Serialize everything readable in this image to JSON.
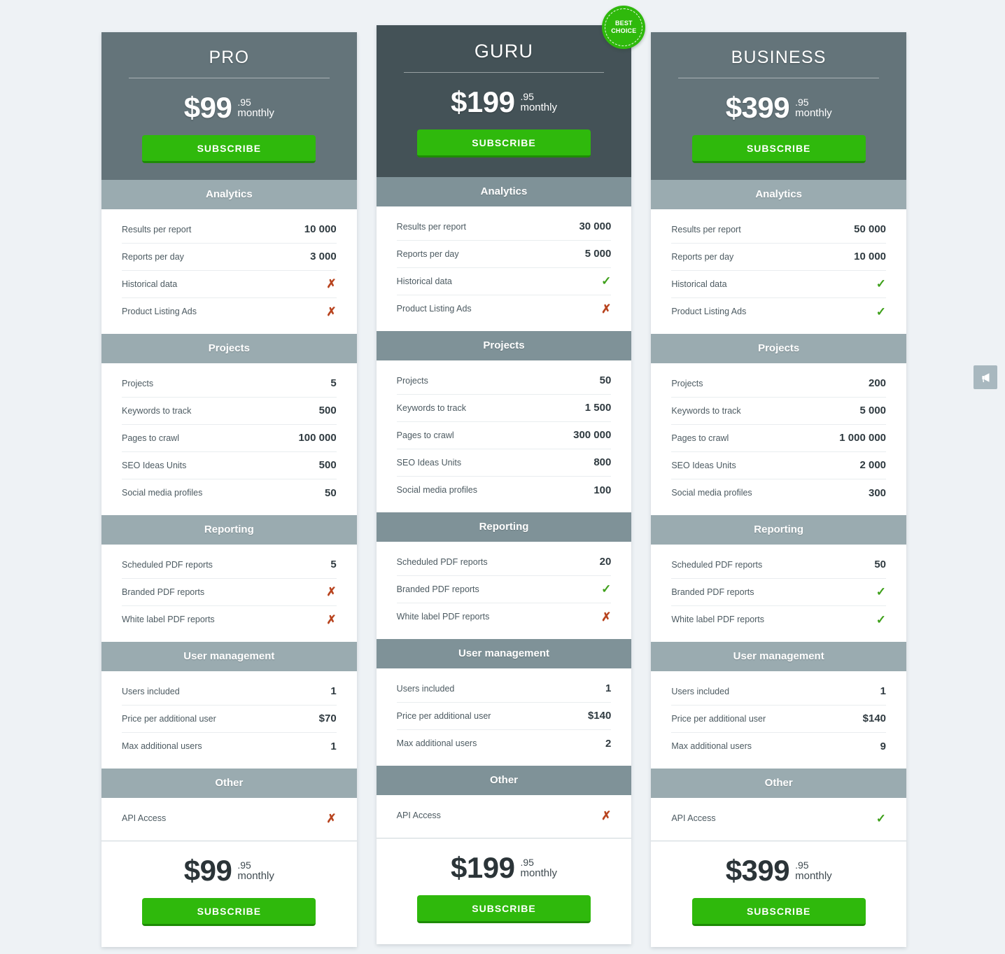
{
  "theme": {
    "page_bg": "#eef2f5",
    "header_bg": "#64747a",
    "featured_header_bg": "#445257",
    "section_bg": "#9aabb0",
    "accent_green": "#2fb90c",
    "yes_green": "#3ea01a",
    "no_red": "#b8441f"
  },
  "labels": {
    "subscribe": "SUBSCRIBE",
    "cents": ".95",
    "period": "monthly",
    "badge_line1": "BEST",
    "badge_line2": "CHOICE"
  },
  "feedback_tab": {
    "icon": "megaphone-icon"
  },
  "sections": [
    {
      "title": "Analytics",
      "rows": [
        "Results per report",
        "Reports per day",
        "Historical data",
        "Product Listing Ads"
      ]
    },
    {
      "title": "Projects",
      "rows": [
        "Projects",
        "Keywords to track",
        "Pages to crawl",
        "SEO Ideas Units",
        "Social media profiles"
      ]
    },
    {
      "title": "Reporting",
      "rows": [
        "Scheduled PDF reports",
        "Branded PDF reports",
        "White label PDF reports"
      ]
    },
    {
      "title": "User management",
      "rows": [
        "Users included",
        "Price per additional user",
        "Max additional users"
      ]
    },
    {
      "title": "Other",
      "rows": [
        "API Access"
      ]
    }
  ],
  "plans": [
    {
      "name": "PRO",
      "price": "$99",
      "featured": false,
      "badge": false,
      "values": [
        [
          "10 000",
          "3 000",
          "no",
          "no"
        ],
        [
          "5",
          "500",
          "100 000",
          "500",
          "50"
        ],
        [
          "5",
          "no",
          "no"
        ],
        [
          "1",
          "$70",
          "1"
        ],
        [
          "no"
        ]
      ]
    },
    {
      "name": "GURU",
      "price": "$199",
      "featured": true,
      "badge": true,
      "values": [
        [
          "30 000",
          "5 000",
          "yes",
          "no"
        ],
        [
          "50",
          "1 500",
          "300 000",
          "800",
          "100"
        ],
        [
          "20",
          "yes",
          "no"
        ],
        [
          "1",
          "$140",
          "2"
        ],
        [
          "no"
        ]
      ]
    },
    {
      "name": "BUSINESS",
      "price": "$399",
      "featured": false,
      "badge": false,
      "values": [
        [
          "50 000",
          "10 000",
          "yes",
          "yes"
        ],
        [
          "200",
          "5 000",
          "1 000 000",
          "2 000",
          "300"
        ],
        [
          "50",
          "yes",
          "yes"
        ],
        [
          "1",
          "$140",
          "9"
        ],
        [
          "yes"
        ]
      ]
    }
  ]
}
